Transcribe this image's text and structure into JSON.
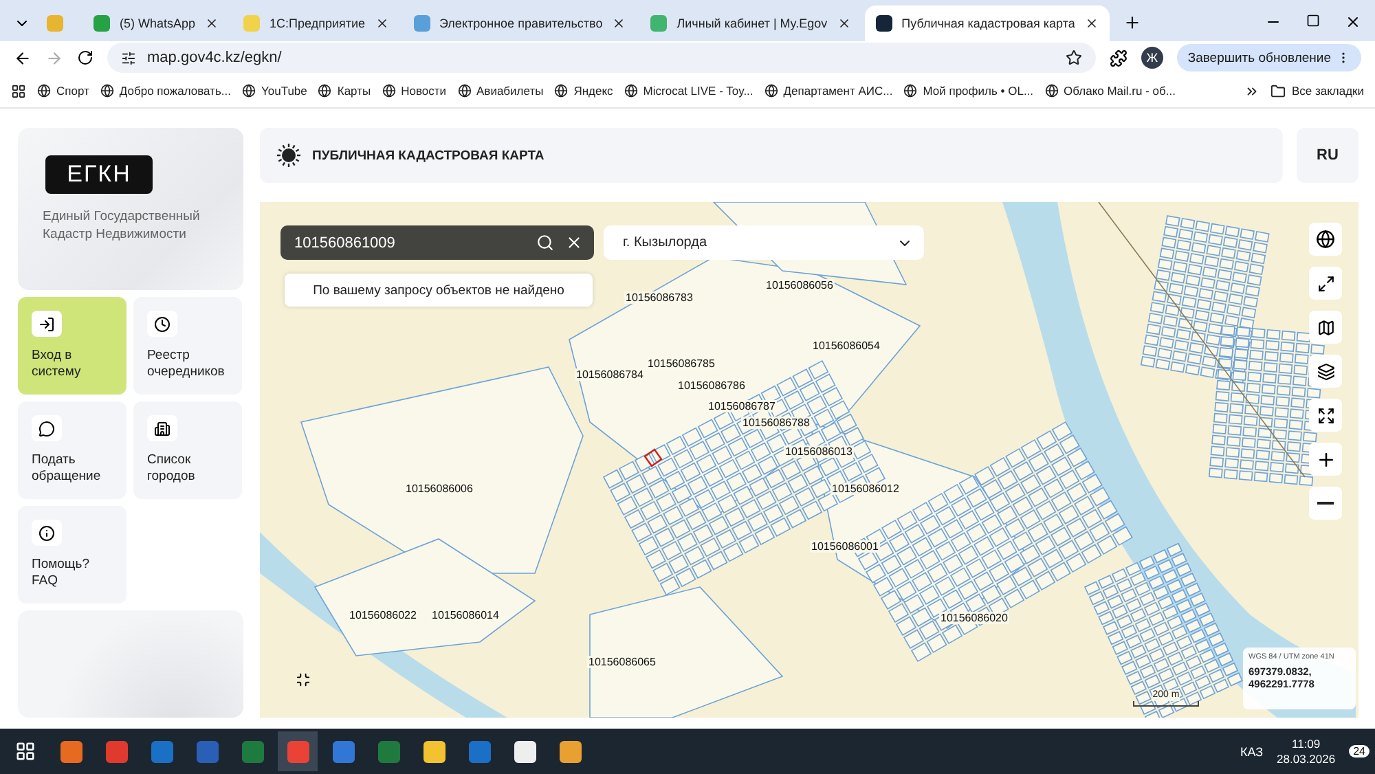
{
  "browser": {
    "tabs": [
      {
        "title": "(5) WhatsApp",
        "selected": false
      },
      {
        "title": "1С:Предприятие",
        "selected": false
      },
      {
        "title": "Электронное правительство",
        "selected": false
      },
      {
        "title": "Личный кабинет | My.Egov",
        "selected": false
      },
      {
        "title": "Публичная кадастровая карта",
        "selected": true
      }
    ],
    "address": "map.gov4c.kz/egkn/",
    "profile": "Ж",
    "update_button": "Завершить обновление",
    "bookmarks": [
      "Спорт",
      "Добро пожаловать...",
      "YouTube",
      "Карты",
      "Новости",
      "Авиабилеты",
      "Яндекс",
      "Microcat LIVE - Toy...",
      "Департамент АИС...",
      "Мой профиль • OL...",
      "Облако Mail.ru - об..."
    ],
    "all_bookmarks": "Все закладки"
  },
  "sidebar": {
    "logo": "ЕГКН",
    "subtitle": "Единый Государственный Кадастр Недвижимости",
    "items": [
      {
        "label": "Вход в систему",
        "selected": true
      },
      {
        "label": "Реестр очередников",
        "selected": false
      },
      {
        "label": "Подать обращение",
        "selected": false
      },
      {
        "label": "Список городов",
        "selected": false
      },
      {
        "label": "Помощь? FAQ",
        "selected": false
      }
    ]
  },
  "header": {
    "title": "ПУБЛИЧНАЯ КАДАСТРОВАЯ КАРТА",
    "language": "RU"
  },
  "map": {
    "search": {
      "value": "101560861009"
    },
    "message": "По вашему запросу объектов не найдено",
    "city": "г. Кызылорда",
    "parcels": [
      "10156086783",
      "10156086056",
      "10156086054",
      "10156086784",
      "10156086785",
      "10156086786",
      "10156086787",
      "10156086788",
      "10156086013",
      "10156086006",
      "10156086012",
      "10156086001",
      "10156086022",
      "10156086014",
      "10156086020",
      "10156086065"
    ],
    "projection": "WGS 84 / UTM zone 41N",
    "coordinates": "697379.0832, 4962291.7778",
    "scale": "200 m"
  },
  "taskbar": {
    "language": "КАЗ",
    "time": "11:09",
    "date": "28.03.2026",
    "notifications": "24"
  }
}
